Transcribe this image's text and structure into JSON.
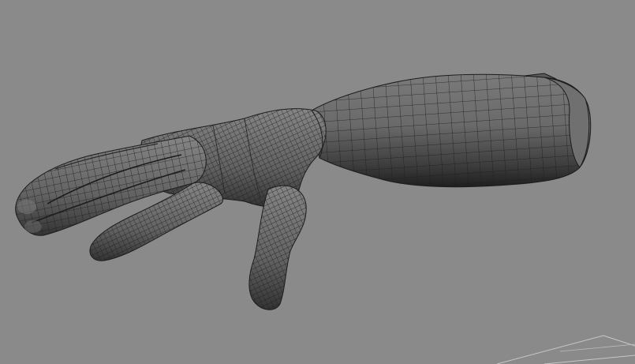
{
  "viewport": {
    "background_color": "#8a8a8a",
    "mesh_fill_color": "#6d6d6d",
    "mesh_wire_color": "#1c1c1c",
    "grid_line_color": "#c8c8c8",
    "model": "hand-mesh",
    "display_mode": "wireframe-on-shaded"
  }
}
